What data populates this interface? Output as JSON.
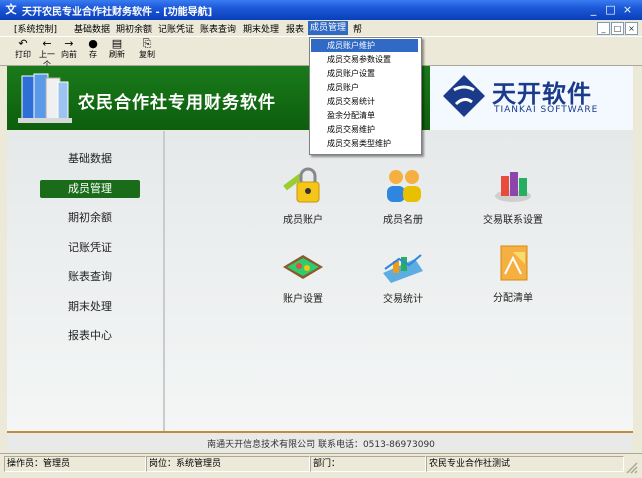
{
  "window": {
    "title": "天开农民专业合作社财务软件 - [功能导航]",
    "icon_glyph": "文",
    "controls": [
      "_",
      "□",
      "×"
    ]
  },
  "menubar": {
    "items": [
      "[系统控制]",
      "基础数据",
      "期初余额",
      "记账凭证",
      "账表查询",
      "期末处理",
      "报表",
      "成员管理",
      "帮"
    ],
    "active_index": 7,
    "mdi_controls": [
      "_",
      "□",
      "×"
    ]
  },
  "toolbar": {
    "items": [
      {
        "icon": "↶",
        "label": "打印"
      },
      {
        "icon": "←",
        "label": "上一个"
      },
      {
        "icon": "→",
        "label": "向前"
      },
      {
        "icon": "●",
        "label": "存"
      },
      {
        "icon": "▤",
        "label": "刷新"
      },
      {
        "icon": "⎘",
        "label": "复制"
      }
    ]
  },
  "banner": {
    "title": "农民合作社专用财务软件",
    "brand_name": "天开软件",
    "brand_sub": "TIANKAI SOFTWARE"
  },
  "sidebar": {
    "items": [
      "基础数据",
      "成员管理",
      "期初余额",
      "记账凭证",
      "账表查询",
      "期末处理",
      "报表中心"
    ],
    "active_index": 1
  },
  "features": [
    {
      "icon": "lock-icon",
      "label": "成员账户"
    },
    {
      "icon": "members-icon",
      "label": "成员名册"
    },
    {
      "icon": "trade-settings-icon",
      "label": "交易联系设置"
    },
    {
      "icon": "account-settings-icon",
      "label": "账户设置"
    },
    {
      "icon": "statistics-icon",
      "label": "交易统计"
    },
    {
      "icon": "distribution-icon",
      "label": "分配清单"
    }
  ],
  "footer": {
    "text": "南通天开信息技术有限公司 联系电话：0513-86973090"
  },
  "statusbar": {
    "operator": "操作员：管理员",
    "position": "岗位：系统管理员",
    "department": "部门：",
    "entity": "农民专业合作社测试"
  },
  "dropdown": {
    "items": [
      "成员账户维护",
      "成员交易参数设置",
      "成员账户设置",
      "成员账户",
      "成员交易统计",
      "盈余分配清单",
      "成员交易维护",
      "成员交易类型维护"
    ],
    "highlight_index": 0
  },
  "colors": {
    "title_blue": "#1c58d8",
    "banner_green": "#0d5e0d",
    "sidebar_active": "#1a6b1a",
    "menu_highlight": "#316ac5"
  }
}
